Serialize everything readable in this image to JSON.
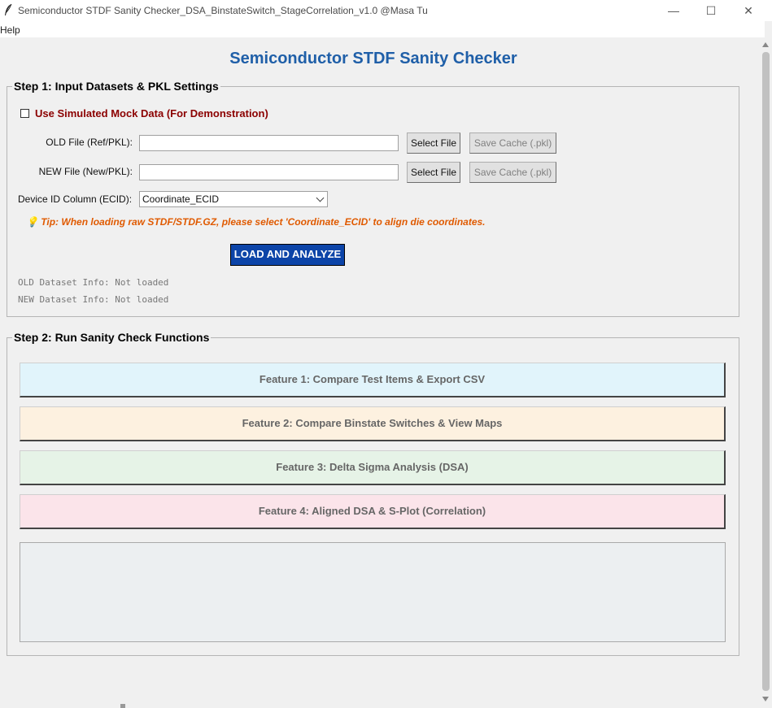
{
  "window": {
    "title": "Semiconductor STDF Sanity Checker_DSA_BinstateSwitch_StageCorrelation_v1.0 @Masa Tu",
    "controls": {
      "minimize": "—",
      "maximize": "☐",
      "close": "✕"
    }
  },
  "menu": {
    "help": "Help"
  },
  "header": {
    "title": "Semiconductor STDF Sanity Checker"
  },
  "step1": {
    "legend": "Step 1: Input Datasets & PKL Settings",
    "mock_label": "Use Simulated Mock Data (For Demonstration)",
    "mock_checked": false,
    "old_label": "OLD File (Ref/PKL):",
    "old_value": "",
    "new_label": "NEW File (New/PKL):",
    "new_value": "",
    "select_file": "Select File",
    "save_cache": "Save Cache (.pkl)",
    "device_label": "Device ID Column (ECID):",
    "device_value": "Coordinate_ECID",
    "tip": "💡 Tip: When loading raw STDF/STDF.GZ, please select 'Coordinate_ECID' to align die coordinates.",
    "load_button": "LOAD AND ANALYZE",
    "old_info": "OLD Dataset Info: Not loaded",
    "new_info": "NEW Dataset Info: Not loaded"
  },
  "step2": {
    "legend": "Step 2: Run Sanity Check Functions",
    "features": [
      {
        "label": "Feature 1: Compare Test Items & Export CSV",
        "color": "#e1f4fb"
      },
      {
        "label": "Feature 2: Compare Binstate Switches & View Maps",
        "color": "#fdf1e0"
      },
      {
        "label": "Feature 3: Delta Sigma Analysis (DSA)",
        "color": "#e6f3e7"
      },
      {
        "label": "Feature 4: Aligned DSA & S-Plot (Correlation)",
        "color": "#fbe4ea"
      }
    ],
    "output_text": ""
  }
}
